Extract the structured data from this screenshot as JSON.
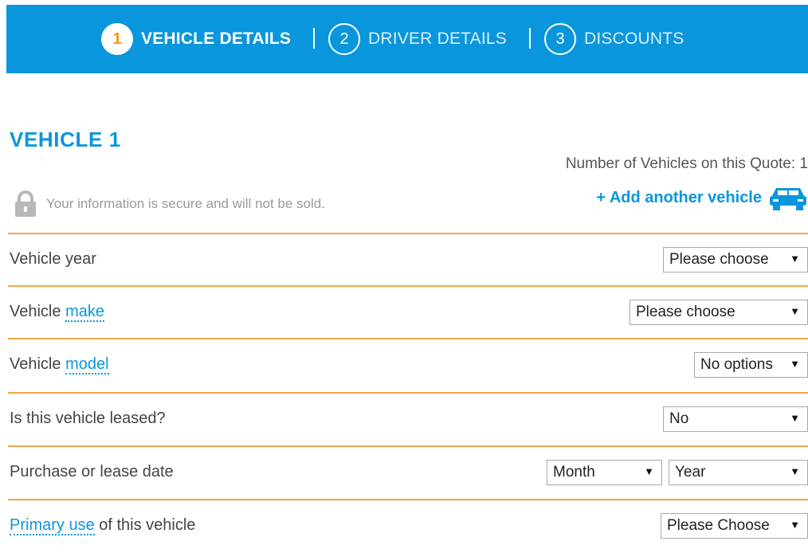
{
  "steps": [
    {
      "num": "1",
      "label": "VEHICLE DETAILS"
    },
    {
      "num": "2",
      "label": "DRIVER DETAILS"
    },
    {
      "num": "3",
      "label": "DISCOUNTS"
    }
  ],
  "heading": "VEHICLE 1",
  "vehicle_count_text": "Number of Vehicles on this Quote: 1",
  "secure_text": "Your information is secure and will not be sold.",
  "add_vehicle_text": "+ Add another vehicle",
  "rows": {
    "year": {
      "label": "Vehicle year",
      "value": "Please choose"
    },
    "make": {
      "label_pre": "Vehicle ",
      "label_link": "make",
      "value": "Please choose"
    },
    "model": {
      "label_pre": "Vehicle ",
      "label_link": "model",
      "value": "No options"
    },
    "leased": {
      "label": "Is this vehicle leased?",
      "value": "No"
    },
    "purchase_date": {
      "label": "Purchase or lease date",
      "month": "Month",
      "year": "Year"
    },
    "primary_use": {
      "label_link": "Primary use",
      "label_post": " of this vehicle",
      "value": "Please Choose"
    }
  },
  "colors": {
    "brand_blue": "#0a96dc",
    "accent_orange": "#f7941d",
    "row_divider": "#f0a54a"
  },
  "icons": {
    "lock": "lock-icon",
    "car": "car-icon",
    "dropdown": "dropdown-arrow-icon"
  }
}
